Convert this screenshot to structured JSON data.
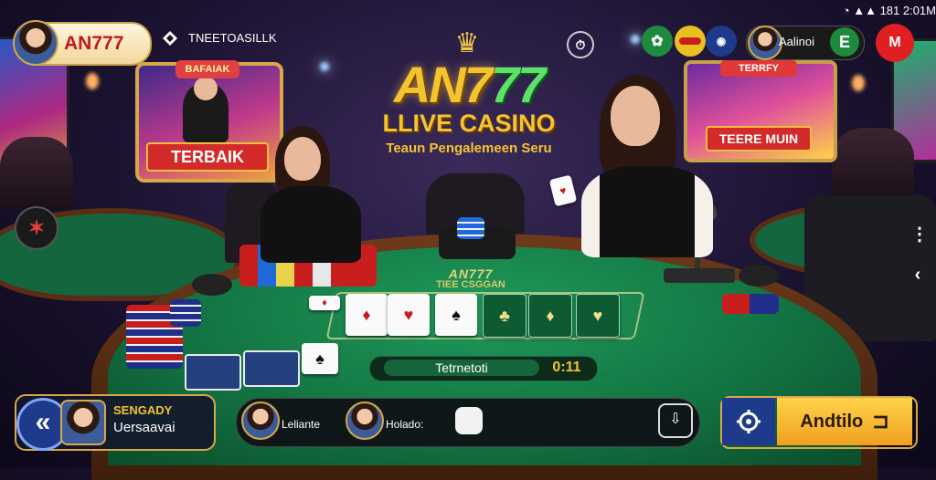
{
  "status_bar": {
    "time": "181 2:01M"
  },
  "profile": {
    "name": "AN777",
    "tagline": "TNEETOASILLK"
  },
  "logo": {
    "brand_prefix": "AN7",
    "brand_suffix": "77",
    "subtitle": "LLIVE CASINO",
    "tagline": "Teaun Pengalemeen Seru"
  },
  "banner_left": {
    "title": "BAFAIAK",
    "ribbon": "TERBAIK"
  },
  "banner_right": {
    "title": "TERRFY",
    "ribbon": "TEERE MUIN"
  },
  "top_right": {
    "user_name": "Aalinoi",
    "badge": "E",
    "red_button": "M"
  },
  "table": {
    "felt_brand": "AN777",
    "felt_sub": "TIEE CSGGAN",
    "status_label": "Tetrnetoti",
    "countdown": "0:11"
  },
  "hud_left": {
    "line1": "SENGADY",
    "line2": "Uersaavai"
  },
  "hud_mid": {
    "player1": "Leliante",
    "player2": "Holado:"
  },
  "hud_right": {
    "action_label": "Andtilo"
  },
  "icons": [
    "chevron-left-icon",
    "settings-icon",
    "share-icon",
    "exit-icon",
    "dice-icon",
    "back-icon",
    "star-icon",
    "wifi-icon"
  ],
  "colors": {
    "accent_gold": "#f4c430",
    "felt_green": "#127040",
    "action_yellow": "#ffd24a",
    "button_blue": "#1e3a8a"
  }
}
